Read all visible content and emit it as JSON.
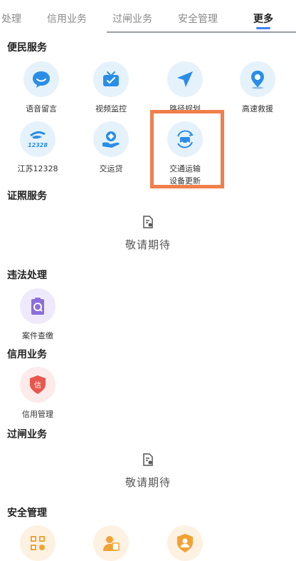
{
  "tabs": [
    "处理",
    "信用业务",
    "过闸业务",
    "安全管理",
    "更多"
  ],
  "active_tab": "更多",
  "sections": {
    "convenience": {
      "title": "便民服务",
      "items": [
        {
          "label": "语音留言",
          "icon": "chat-bubble-icon"
        },
        {
          "label": "视频监控",
          "icon": "tv-icon"
        },
        {
          "label": "路径规划",
          "icon": "navigation-arrow-icon"
        },
        {
          "label": "高速救援",
          "icon": "location-pin-icon"
        },
        {
          "label": "江苏12328",
          "icon": "jiangsu-12328-logo-icon"
        },
        {
          "label": "交运贷",
          "icon": "loan-hand-icon"
        },
        {
          "label": "交通运输设备更新",
          "line1": "交通运输",
          "line2": "设备更新",
          "icon": "vehicle-refresh-icon"
        }
      ]
    },
    "license": {
      "title": "证照服务",
      "empty_text": "敬请期待"
    },
    "violation": {
      "title": "违法处理",
      "items": [
        {
          "label": "案件查缴",
          "icon": "case-clipboard-icon"
        }
      ]
    },
    "credit": {
      "title": "信用业务",
      "items": [
        {
          "label": "信用管理",
          "icon": "credit-shield-icon",
          "glyph": "信"
        }
      ]
    },
    "lock": {
      "title": "过闸业务",
      "empty_text": "敬请期待"
    },
    "safety": {
      "title": "安全管理",
      "items": [
        {
          "icon": "qr-code-icon"
        },
        {
          "icon": "inspector-person-icon"
        },
        {
          "icon": "safety-shield-person-icon"
        }
      ]
    }
  },
  "colors": {
    "accent": "#3b82f6",
    "highlight": "#f07f4a",
    "icon_blue": "#2a8ee8",
    "icon_purple": "#8b6fd9",
    "icon_red": "#e8574d",
    "icon_orange": "#f2a233"
  }
}
